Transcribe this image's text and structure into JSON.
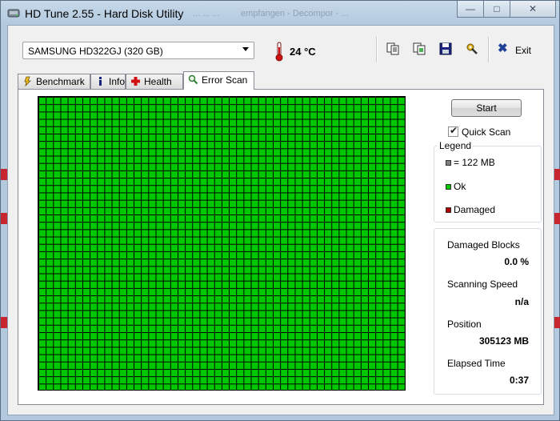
{
  "window": {
    "title": "HD Tune 2.55 - Hard Disk Utility",
    "ghost_titles": [
      "... ... ...",
      "empfangen - Decompor - ..."
    ]
  },
  "toolbar": {
    "drive_selected": "SAMSUNG HD322GJ (320 GB)",
    "temperature": "24 °C",
    "exit_label": "Exit",
    "icons": [
      "copy-info-icon",
      "copy-screenshot-icon",
      "save-icon",
      "options-icon",
      "exit-icon"
    ]
  },
  "tabs": [
    {
      "label": "Benchmark",
      "icon": "benchmark-icon"
    },
    {
      "label": "Info",
      "icon": "info-icon"
    },
    {
      "label": "Health",
      "icon": "health-icon"
    },
    {
      "label": "Error Scan",
      "icon": "magnifier-icon",
      "active": true
    }
  ],
  "error_scan": {
    "start_label": "Start",
    "quick_scan_label": "Quick Scan",
    "quick_scan_checked": true,
    "legend": {
      "title": "Legend",
      "items": [
        {
          "label": "= 122 MB",
          "color": "#808080"
        },
        {
          "label": "Ok",
          "color": "#00c800"
        },
        {
          "label": "Damaged",
          "color": "#b00000"
        }
      ]
    },
    "stats": {
      "damaged_blocks_label": "Damaged Blocks",
      "damaged_blocks_value": "0.0 %",
      "scanning_speed_label": "Scanning Speed",
      "scanning_speed_value": "n/a",
      "position_label": "Position",
      "position_value": "305123 MB",
      "elapsed_time_label": "Elapsed Time",
      "elapsed_time_value": "0:37"
    },
    "block_color_ok": "#00c800",
    "block_state": "all-ok"
  }
}
